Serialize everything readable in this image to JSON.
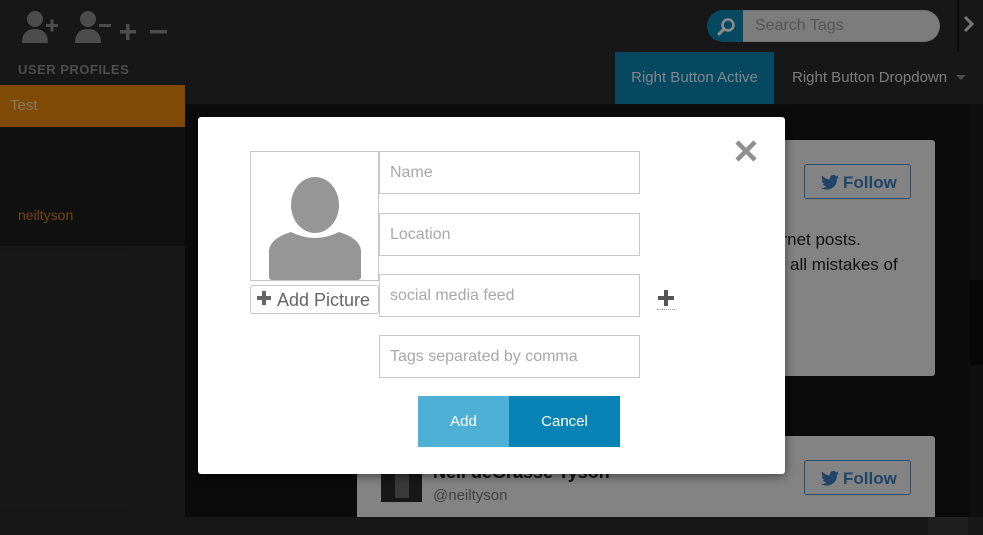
{
  "topbar": {
    "icons": [
      "add-user-icon",
      "remove-user-icon",
      "plus-icon",
      "minus-icon"
    ],
    "search": {
      "placeholder": "Search Tags"
    }
  },
  "sidebar": {
    "header": "USER PROFILES",
    "items": [
      {
        "label": "Test",
        "active": true
      },
      {
        "label": "neiltyson",
        "active": false
      }
    ]
  },
  "nav": {
    "active_button": "Right Button Active",
    "dropdown_button": "Right Button Dropdown"
  },
  "cards": [
    {
      "follow_label": "Follow",
      "text_line1": "ernet posts.",
      "text_line2": "all mistakes of"
    },
    {
      "name": "Neil deGrasse Tyson",
      "handle": "@neiltyson",
      "follow_label": "Follow"
    }
  ],
  "modal": {
    "add_picture_label": "Add Picture",
    "fields": {
      "name_placeholder": "Name",
      "location_placeholder": "Location",
      "feed_placeholder": "social media feed",
      "tags_placeholder": "Tags separated by comma"
    },
    "add_label": "Add",
    "cancel_label": "Cancel"
  },
  "colors": {
    "accent_blue": "#0e83b1",
    "accent_orange": "#e7870a",
    "twitter_blue": "#3b7ec0"
  }
}
